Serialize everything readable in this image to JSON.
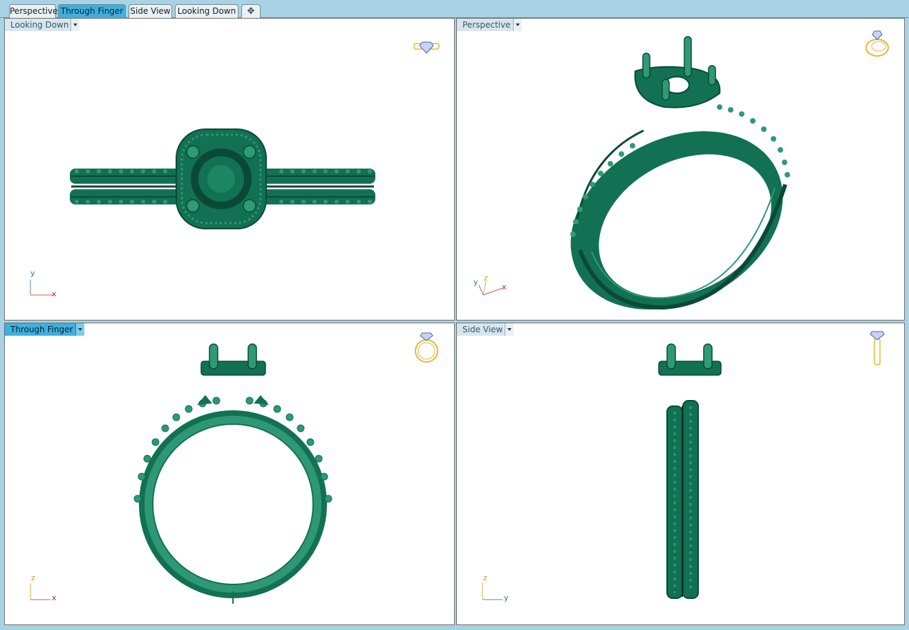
{
  "tabs": [
    {
      "label": "Perspective",
      "active": false
    },
    {
      "label": "Through Finger",
      "active": true
    },
    {
      "label": "Side View",
      "active": false
    },
    {
      "label": "Looking Down",
      "active": false
    }
  ],
  "new_tab_icon": "plus-icon",
  "viewports": {
    "top_left": {
      "title": "Looking Down",
      "active": false,
      "axes": [
        "x",
        "y"
      ],
      "widget_icon": "ring-top-view-icon"
    },
    "top_right": {
      "title": "Perspective",
      "active": false,
      "axes": [
        "x",
        "y",
        "z"
      ],
      "widget_icon": "ring-perspective-icon"
    },
    "bottom_left": {
      "title": "Through Finger",
      "active": true,
      "axes": [
        "x",
        "z"
      ],
      "widget_icon": "ring-front-view-icon"
    },
    "bottom_right": {
      "title": "Side View",
      "active": false,
      "axes": [
        "y",
        "z"
      ],
      "widget_icon": "ring-side-view-icon"
    }
  },
  "colors": {
    "model_green": "#127152",
    "model_green_dark": "#0a4a35",
    "model_green_light": "#2f9a73",
    "active_blue": "#3eb0e0",
    "frame_blue": "#a9d3e4",
    "axis_x": "#b3261e",
    "axis_y": "#2c6f9e",
    "axis_z": "#d19a22",
    "widget_gold": "#e7b53a"
  }
}
